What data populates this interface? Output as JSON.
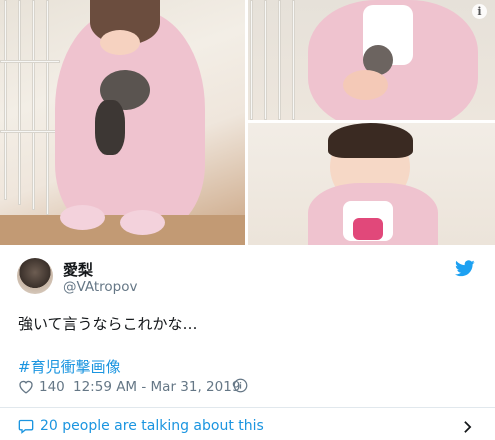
{
  "tweet": {
    "display_name": "愛梨",
    "handle": "@VAtropov",
    "text": "強いて言うならこれかな…",
    "hashtag": "#育児衝撃画像",
    "like_count": "140",
    "timestamp": "12:59 AM - Mar 31, 2019",
    "talking_label": "20 people are talking about this"
  },
  "colors": {
    "link": "#1b95e0",
    "secondary_text": "#657786",
    "primary_text": "#14171a",
    "divider": "#e1e8ed"
  },
  "icons": {
    "brand": "twitter-bird-icon",
    "like": "heart-outline-icon",
    "info": "info-circle-icon",
    "comment": "speech-bubble-icon",
    "chevron": "chevron-right-icon"
  }
}
